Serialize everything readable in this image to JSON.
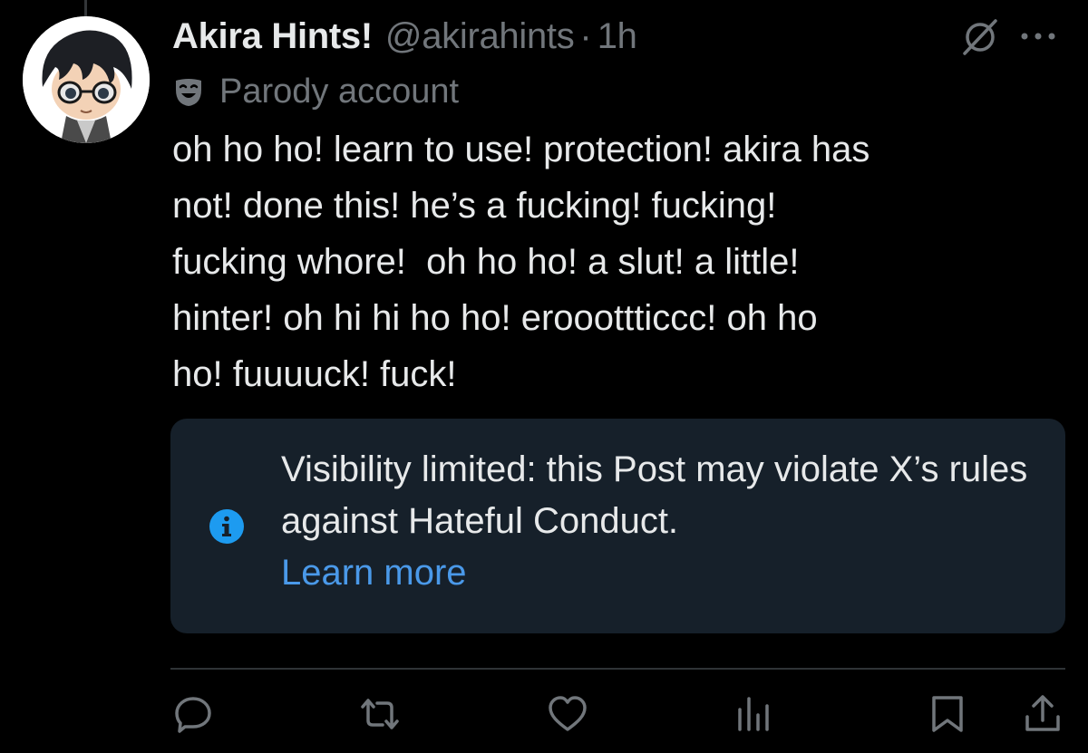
{
  "post": {
    "display_name": "Akira Hints!",
    "handle": "@akirahints",
    "separator": "·",
    "time": "1h",
    "label_icon": "theater-mask-icon",
    "label": "Parody account",
    "text": "oh ho ho! learn to use! protection! akira has\nnot! done this! he’s a fucking! fucking!\nfucking whore!  oh ho ho! a slut! a little!\nhinter! oh hi hi ho ho! erooottticcc! oh ho\nho! fuuuuck! fuck!"
  },
  "notice": {
    "icon": "info-icon",
    "message": "Visibility limited: this Post may violate X’s rules against Hateful Conduct.",
    "link": "Learn more",
    "background": "#16202a",
    "link_color": "#4a99e9"
  },
  "header_icons": [
    "grok-icon",
    "more-options-icon"
  ],
  "actions": [
    "reply-icon",
    "repost-icon",
    "like-icon",
    "views-icon",
    "bookmark-icon",
    "share-icon"
  ],
  "colors": {
    "background": "#000000",
    "text": "#e7e9ea",
    "secondary": "#71767b",
    "accent": "#1d9bf0"
  }
}
